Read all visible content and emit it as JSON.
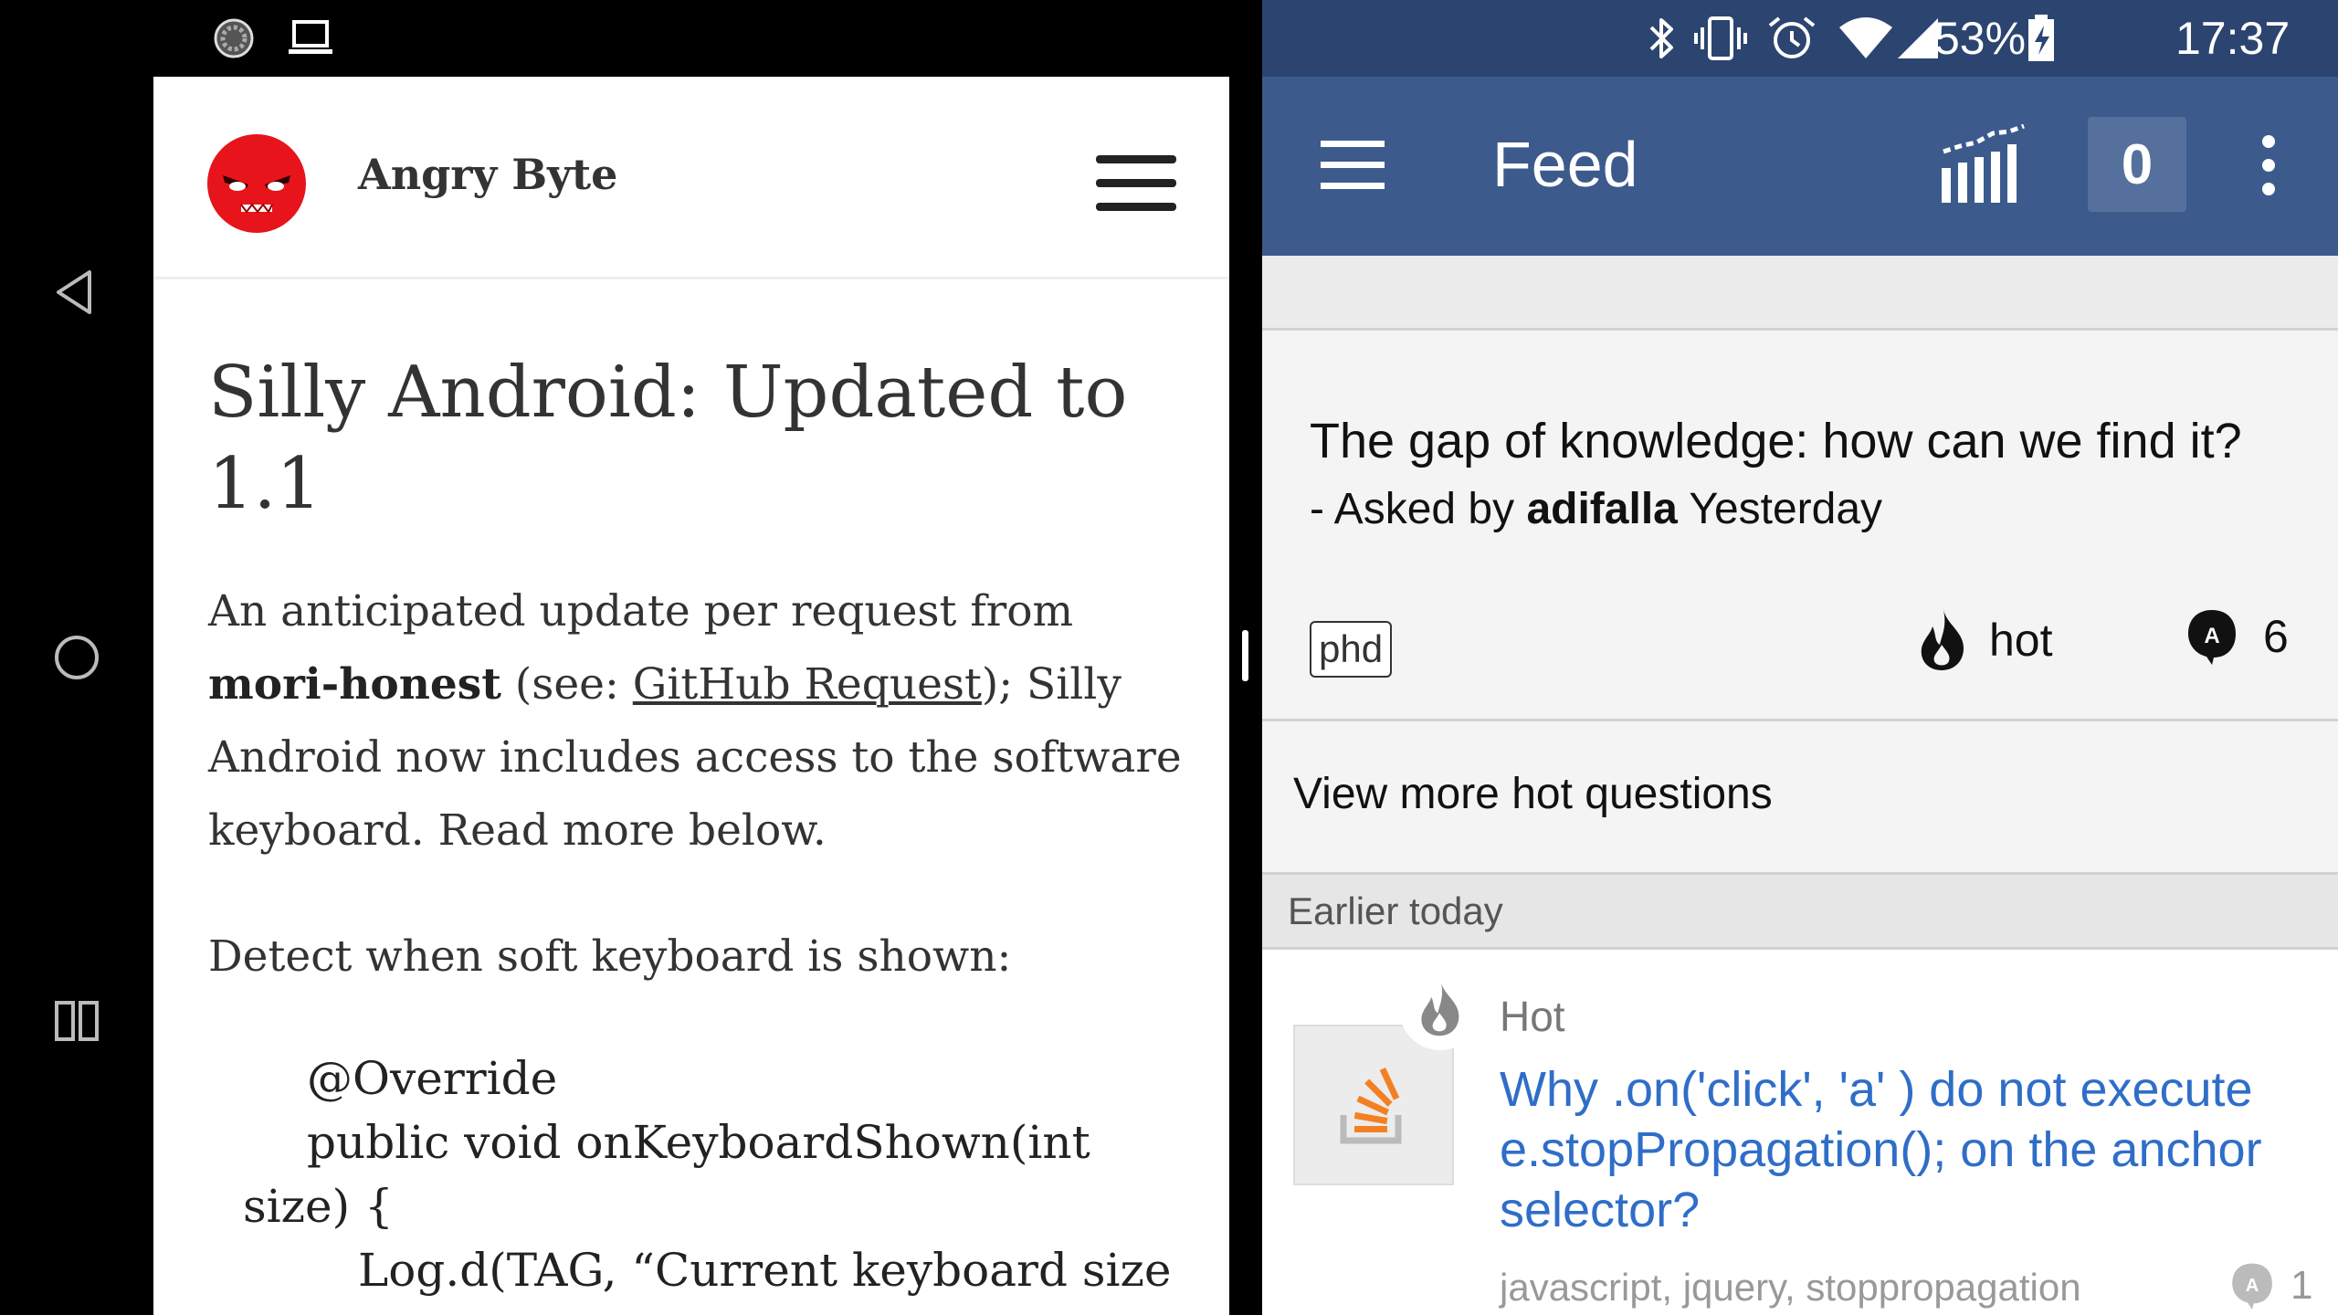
{
  "left_status": {
    "icons": [
      "sync-icon",
      "laptop-icon"
    ]
  },
  "nav": {
    "back_icon": "back-triangle-icon",
    "home_icon": "home-circle-icon",
    "recents_icon": "split-screen-icon"
  },
  "browser": {
    "site_title": "Angry Byte",
    "post_title": "Silly Android: Updated to 1.1",
    "para1_before": "An anticipated update per request from ",
    "para1_bold": "mori-honest",
    "para1_see": " (see: ",
    "para1_link": "GitHub Request",
    "para1_after": "); Silly Android now includes access to the software keyboard. Read more below.",
    "para2": "Detect when soft keyboard is shown:",
    "code_lines": [
      "@Override",
      "public void onKeyboardShown(int",
      "size) {",
      "Log.d(TAG, “Current keyboard size"
    ]
  },
  "right_status": {
    "battery": "53%",
    "time": "17:37",
    "icons": [
      "bluetooth-icon",
      "vibrate-icon",
      "alarm-icon",
      "wifi-icon",
      "signal-icon",
      "battery-charging-icon"
    ]
  },
  "app_bar": {
    "title": "Feed",
    "counter": "0"
  },
  "hot_card": {
    "title": "The gap of knowledge: how can we find it?",
    "meta_prefix": "- Asked by ",
    "meta_user": "adifalla",
    "meta_time": " Yesterday",
    "tag": "phd",
    "hot_label": "hot",
    "answers": "6"
  },
  "view_more": "View more hot questions",
  "section_header": "Earlier today",
  "feed_item": {
    "hot_label": "Hot",
    "title": "Why .on('click', 'a' ) do not execute e.stopPropagation(); on the anchor selector?",
    "tags": "javascript, jquery, stoppropagation",
    "answers": "1"
  },
  "colors": {
    "status_bar_right": "#2c4470",
    "app_bar": "#3c5a8c",
    "counter_bg": "#55709c",
    "link_blue": "#2f6ec8",
    "logo_red": "#e8141c"
  }
}
